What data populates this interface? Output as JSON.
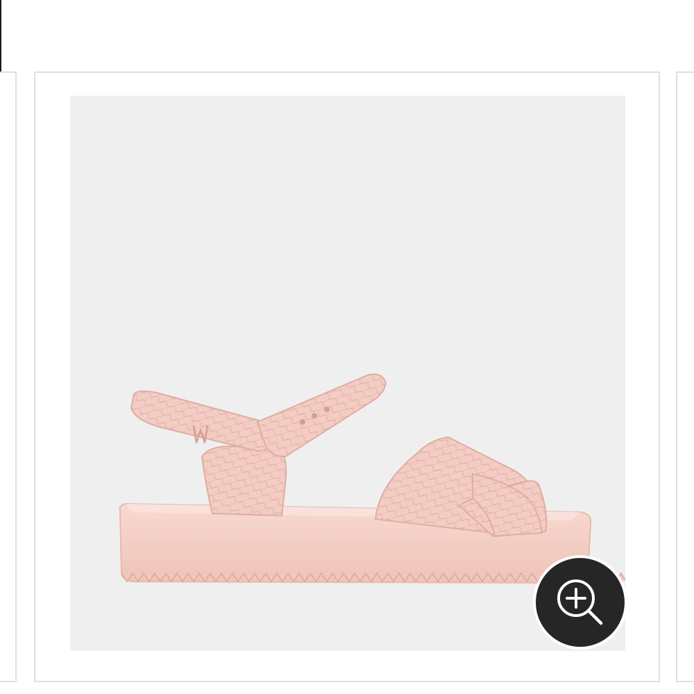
{
  "gallery": {
    "main_image": {
      "description_icon": "product-image"
    },
    "zoom_button": {
      "icon": "zoom-in-icon"
    }
  },
  "colors": {
    "background": "#ffffff",
    "card_border": "#e0e0e0",
    "image_background": "#efeff0",
    "product_pink": "#f4cfc6",
    "zoom_button_bg": "#262626",
    "zoom_button_fg": "#ffffff"
  }
}
